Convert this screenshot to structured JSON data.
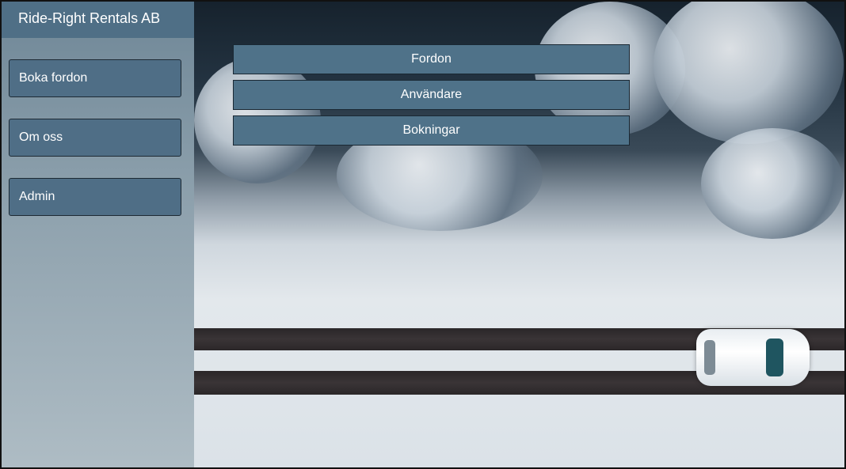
{
  "brand": {
    "title": "Ride-Right Rentals AB"
  },
  "sidebar": {
    "items": [
      {
        "label": "Boka fordon"
      },
      {
        "label": "Om oss"
      },
      {
        "label": "Admin"
      }
    ]
  },
  "admin_menu": {
    "items": [
      {
        "label": "Fordon"
      },
      {
        "label": "Användare"
      },
      {
        "label": "Bokningar"
      }
    ]
  },
  "colors": {
    "sidebar_button": "#4f6e86",
    "header": "#4f6f86",
    "admin_button": "#4f7289"
  },
  "hero": {
    "image_subject": "snowy-road-car-aerial"
  }
}
